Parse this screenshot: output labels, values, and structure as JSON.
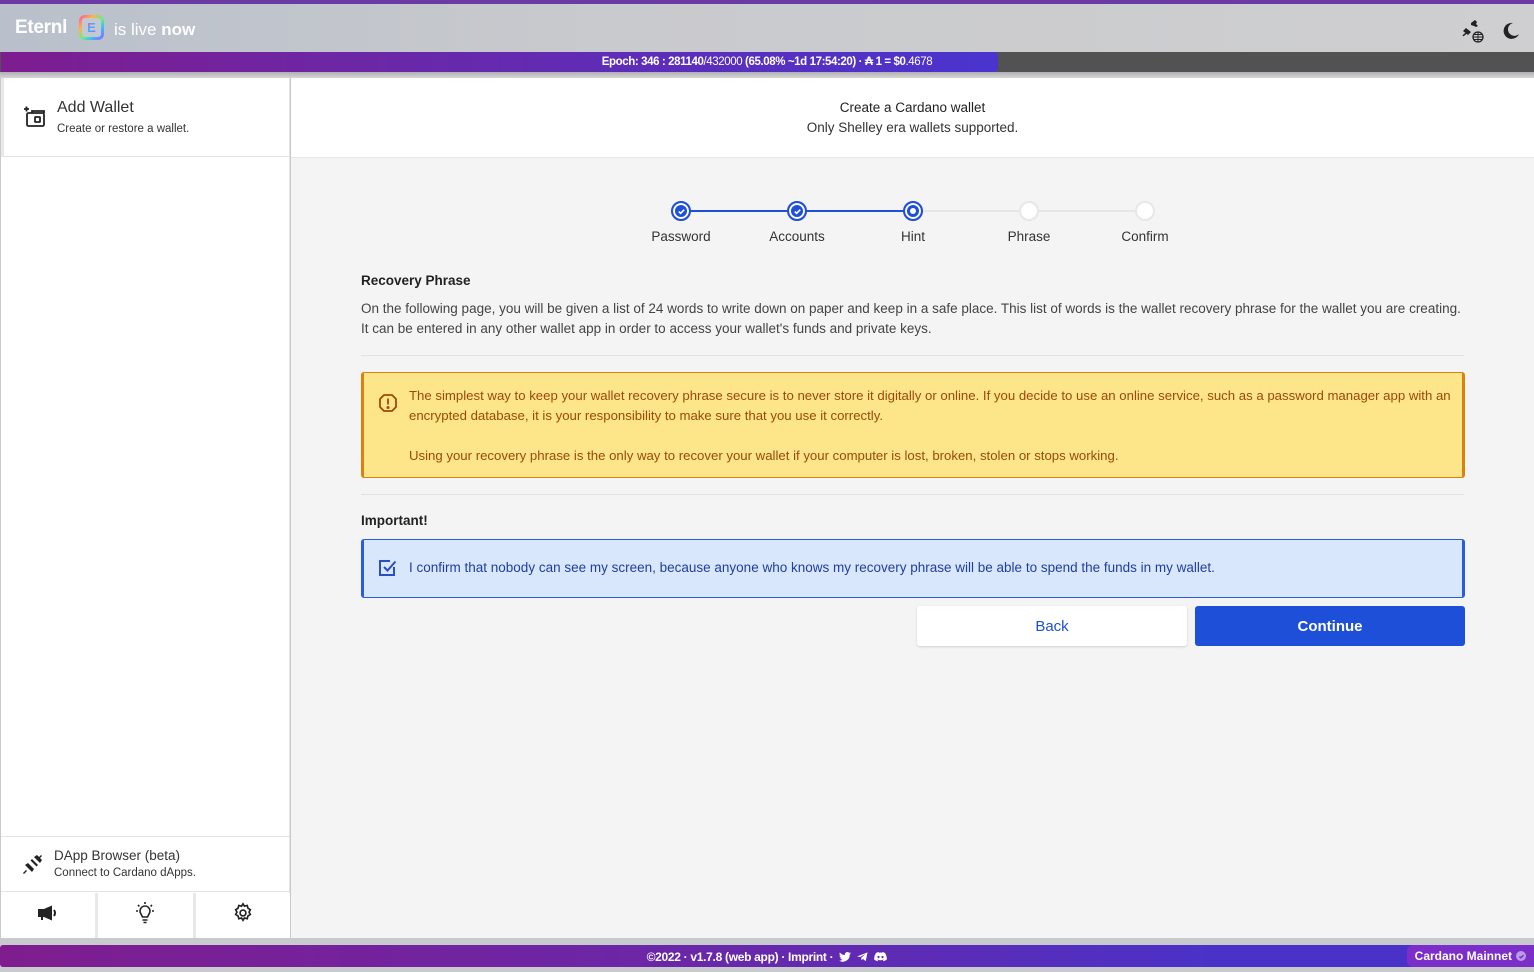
{
  "header": {
    "brand": "Eternl",
    "logo_letter": "E",
    "tagline_prefix": "is live",
    "tagline_suffix": "now",
    "icons": [
      "dapp-connect-globe-icon",
      "dark-mode-moon-icon"
    ]
  },
  "epoch_bar": {
    "label": "Epoch: 346 : 281140",
    "total_slots": "/432000",
    "progress_text": "(65.08% ~1d 17:54:20)",
    "price_label": "· ₳ 1 = $0",
    "price_decimals": ".4678",
    "progress_percent": 65.08
  },
  "sidebar": {
    "add_wallet": {
      "icon": "add-wallet-icon",
      "title": "Add Wallet",
      "subtitle": "Create or restore a wallet."
    },
    "dapp_browser": {
      "icon": "plug-icon",
      "title": "DApp Browser (beta)",
      "subtitle": "Connect to Cardano dApps."
    },
    "bottom_buttons": [
      {
        "icon": "megaphone-icon"
      },
      {
        "icon": "lightbulb-icon"
      },
      {
        "icon": "gear-icon"
      }
    ]
  },
  "main": {
    "title": "Create a Cardano wallet",
    "subtitle": "Only Shelley era wallets supported.",
    "steps": [
      {
        "label": "Password",
        "state": "done"
      },
      {
        "label": "Accounts",
        "state": "done"
      },
      {
        "label": "Hint",
        "state": "active"
      },
      {
        "label": "Phrase",
        "state": "todo"
      },
      {
        "label": "Confirm",
        "state": "todo"
      }
    ],
    "recovery": {
      "title": "Recovery Phrase",
      "body": "On the following page, you will be given a list of 24 words to write down on paper and keep in a safe place. This list of words is the wallet recovery phrase for the wallet you are creating. It can be entered in any other wallet app in order to access your wallet's funds and private keys."
    },
    "warning": {
      "paragraph1": "The simplest way to keep your wallet recovery phrase secure is to never store it digitally or online. If you decide to use an online service, such as a password manager app with an encrypted database, it is your responsibility to make sure that you use it correctly.",
      "paragraph2": "Using your recovery phrase is the only way to recover your wallet if your computer is lost, broken, stolen or stops working."
    },
    "important": {
      "title": "Important!",
      "confirm_text": "I confirm that nobody can see my screen, because anyone who knows my recovery phrase will be able to spend the funds in my wallet.",
      "checked": true
    },
    "buttons": {
      "back": "Back",
      "continue": "Continue"
    }
  },
  "footer": {
    "text": "©2022 · v1.7.8 (web app) · Imprint ·",
    "social_icons": [
      "twitter-icon",
      "telegram-icon",
      "discord-icon"
    ],
    "network": "Cardano Mainnet"
  },
  "colors": {
    "accent": "#1e4fd8",
    "warning_bg": "#fde589",
    "warning_border": "#d9820c",
    "info_bg": "#d9e7fd",
    "brand_purple": "#7b2ec8"
  }
}
